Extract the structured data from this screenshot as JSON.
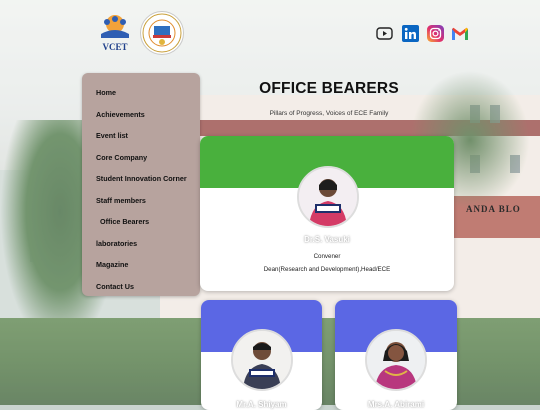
{
  "logos": {
    "college_text": "VCET"
  },
  "social": [
    {
      "icon": "youtube-icon"
    },
    {
      "icon": "linkedin-icon"
    },
    {
      "icon": "instagram-icon"
    },
    {
      "icon": "gmail-icon"
    }
  ],
  "menu": [
    {
      "label": "Home"
    },
    {
      "label": "Achievements"
    },
    {
      "label": "Event list"
    },
    {
      "label": "Core Company"
    },
    {
      "label": "Student Innovation Corner"
    },
    {
      "label": "Staff members"
    },
    {
      "label": "Office Bearers"
    },
    {
      "label": "laboratories"
    },
    {
      "label": "Magazine"
    },
    {
      "label": "Contact Us"
    }
  ],
  "page": {
    "title": "OFFICE BEARERS",
    "subtitle": "Pillars of Progress, Voices of ECE Family"
  },
  "building_sign": "ANDA BLO",
  "cards": [
    {
      "name": "Dr.S. Vasuki",
      "role": "Convener",
      "designation": "Dean(Research and Development),Head/ECE",
      "band_color": "#49b03d"
    },
    {
      "name": "Mr.A. Shiyam",
      "band_color": "#5b67e4"
    },
    {
      "name": "Mrs.A. Abirami",
      "band_color": "#5b67e4"
    }
  ]
}
